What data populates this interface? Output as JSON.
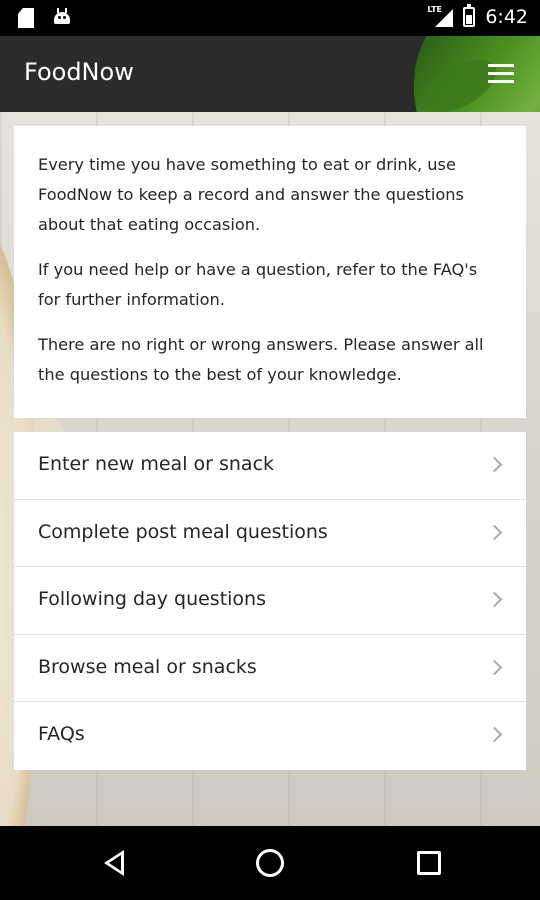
{
  "status_bar": {
    "time": "6:42",
    "network": "LTE",
    "icons": [
      "sd-card-icon",
      "android-icon",
      "lte-signal-icon",
      "battery-icon"
    ]
  },
  "app_bar": {
    "title": "FoodNow",
    "menu_icon": "hamburger-menu-icon"
  },
  "intro": {
    "paragraphs": [
      "Every time you have something to eat or drink, use FoodNow to keep a record and answer the questions about that eating occasion.",
      "If you need help or have a question, refer to the FAQ's for further information.",
      "There are no right or wrong answers. Please answer all the questions to the best of your knowledge."
    ]
  },
  "menu": {
    "items": [
      {
        "label": "Enter new meal or snack",
        "icon": "chevron-right-icon"
      },
      {
        "label": "Complete post meal questions",
        "icon": "chevron-right-icon"
      },
      {
        "label": "Following day questions",
        "icon": "chevron-right-icon"
      },
      {
        "label": "Browse meal or snacks",
        "icon": "chevron-right-icon"
      },
      {
        "label": "FAQs",
        "icon": "chevron-right-icon"
      }
    ]
  },
  "nav_bar": {
    "buttons": [
      "back-icon",
      "home-icon",
      "recents-icon"
    ]
  }
}
